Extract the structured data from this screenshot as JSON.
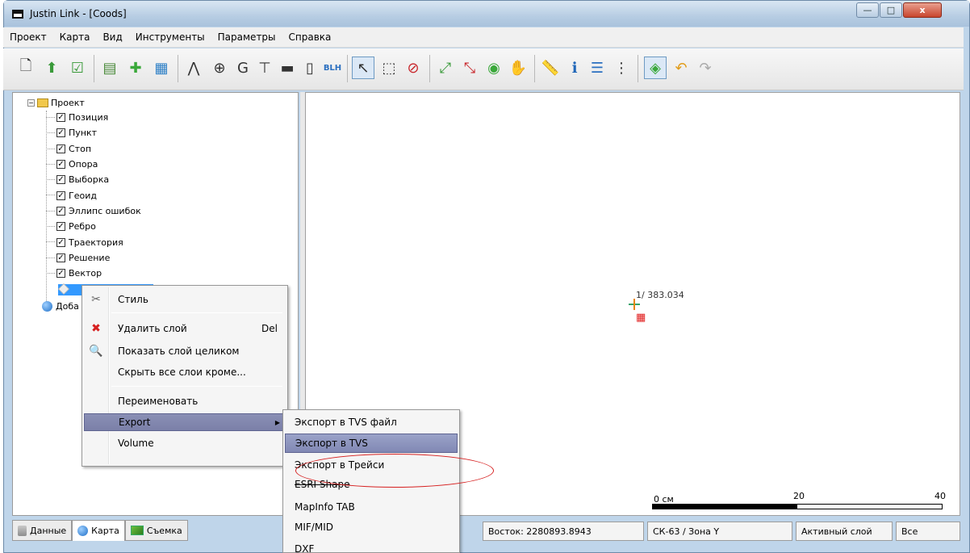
{
  "window": {
    "title": "Justin Link - [Coods]"
  },
  "titlebar_buttons": {
    "minimize": "—",
    "maximize": "□",
    "close": "x"
  },
  "menu": [
    "Проект",
    "Карта",
    "Вид",
    "Инструменты",
    "Параметры",
    "Справка"
  ],
  "toolbar": {
    "icons": [
      "new-file-icon",
      "open-file-icon",
      "save-file-icon",
      "import-layer-icon",
      "add-layer-icon",
      "layer-properties-icon",
      "tripod-icon",
      "antenna-icon",
      "g-icon",
      "station-icon",
      "rectangle-icon",
      "cylinder-icon",
      "blh-icon",
      "select-arrow-icon",
      "select-area-icon",
      "no-select-icon",
      "zoom-in-icon",
      "zoom-out-icon",
      "zoom-extent-icon",
      "pan-hand-icon",
      "ruler-icon",
      "info-icon",
      "list-icon",
      "list-numbered-icon",
      "layer-toggle-icon",
      "undo-icon",
      "redo-icon"
    ]
  },
  "tree": {
    "root": "Проект",
    "items": [
      "Позиция",
      "Пункт",
      "Стоп",
      "Опора",
      "Выборка",
      "Геоид",
      "Эллипс ошибок",
      "Ребро",
      "Траектория",
      "Решение",
      "Вектор"
    ],
    "extra": "Доба"
  },
  "context_menu": {
    "items": [
      {
        "label": "Стиль",
        "shortcut": "",
        "icon": "style-icon"
      },
      {
        "label": "Удалить слой",
        "shortcut": "Del",
        "icon": "delete-icon"
      },
      {
        "label": "Показать слой целиком",
        "shortcut": "",
        "icon": "zoom-layer-icon"
      },
      {
        "label": "Скрыть все слои кроме...",
        "shortcut": "",
        "icon": ""
      },
      {
        "label": "Переименовать",
        "shortcut": "",
        "icon": ""
      },
      {
        "label": "Export",
        "shortcut": "",
        "icon": ""
      },
      {
        "label": "Volume",
        "shortcut": "",
        "icon": ""
      }
    ]
  },
  "submenu": {
    "items": [
      "Экспорт в TVS файл",
      "Экспорт в TVS",
      "Экспорт в Трейси",
      "ESRI Shape",
      "MapInfo TAB",
      "MIF/MID",
      "DXF"
    ]
  },
  "map": {
    "point_label": "1/ 383.034",
    "point_glyph": "&#9638;",
    "scale": {
      "start": "0 см",
      "mid": "20",
      "end": "40"
    }
  },
  "bottom_tabs": [
    "Данные",
    "Карта",
    "Съемка"
  ],
  "status": {
    "east": "Восток: 2280893.8943",
    "crs": "СК-63 / Зона Y",
    "active_layer_label": "Активный слой",
    "active_layer_value": "Все"
  },
  "colors": {
    "selection": "#3399ff",
    "menu_hover": "#8a8fb5",
    "annotation": "#d62020"
  }
}
